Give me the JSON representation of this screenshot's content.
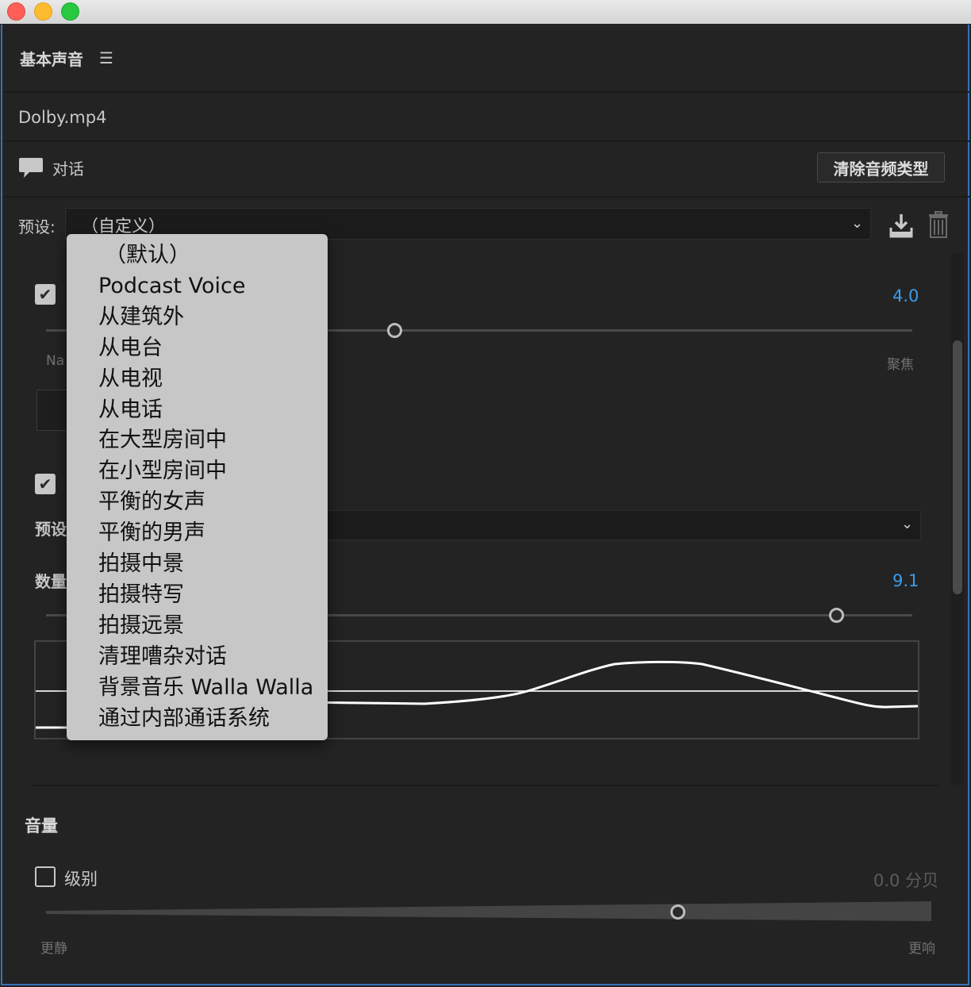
{
  "panel": {
    "title": "基本声音"
  },
  "file": {
    "name": "Dolby.mp4"
  },
  "audio_type": {
    "label": "对话",
    "clear_button": "清除音频类型"
  },
  "preset": {
    "label": "预设:",
    "value": "（自定义）"
  },
  "clarity": {
    "value": "4.0",
    "value_fraction": 0.4,
    "left_label_partial": "Na",
    "right_label": "聚焦"
  },
  "enhance": {
    "preset_label_partial": "预设",
    "amount_label_partial": "数量",
    "amount_value": "9.1",
    "amount_fraction": 0.91
  },
  "volume": {
    "section_title": "音量",
    "level_label": "级别",
    "level_value": "0.0 分贝",
    "level_fraction": 0.7,
    "left_label": "更静",
    "right_label": "更响"
  },
  "preset_menu": {
    "items": [
      "（默认）",
      "Podcast Voice",
      "从建筑外",
      "从电台",
      "从电视",
      "从电话",
      "在大型房间中",
      "在小型房间中",
      "平衡的女声",
      "平衡的男声",
      "拍摄中景",
      "拍摄特写",
      "拍摄远景",
      "清理嘈杂对话",
      "背景音乐 Walla Walla",
      "通过内部通话系统"
    ]
  },
  "colors": {
    "accent_blue": "#3d9be9",
    "focus_border": "#3b6fb5"
  },
  "icons": {
    "menu": "hamburger-icon",
    "dialogue": "speech-bubble-icon",
    "download": "download-icon",
    "delete": "trash-icon",
    "dropdown": "chevron-down-icon",
    "check": "checkmark-icon"
  }
}
